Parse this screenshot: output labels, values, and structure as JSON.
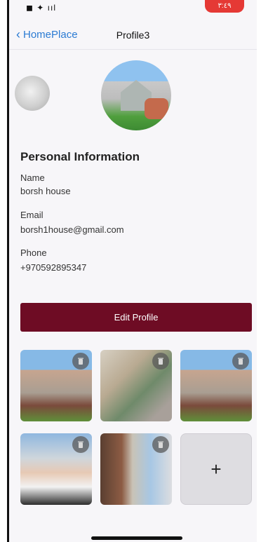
{
  "status_bar": {
    "icons_text": "◼ ✦ ııl",
    "time_pill": "٣:٤٩"
  },
  "nav": {
    "back_label": "HomePlace",
    "title": "Profile3"
  },
  "info": {
    "section_title": "Personal Information",
    "name_label": "Name",
    "name_value": "borsh house",
    "email_label": "Email",
    "email_value": "borsh1house@gmail.com",
    "phone_label": "Phone",
    "phone_value": "+970592895347"
  },
  "actions": {
    "edit_label": "Edit Profile",
    "add_label": "+"
  },
  "colors": {
    "accent": "#6e0c24",
    "link": "#2b7bd3"
  }
}
